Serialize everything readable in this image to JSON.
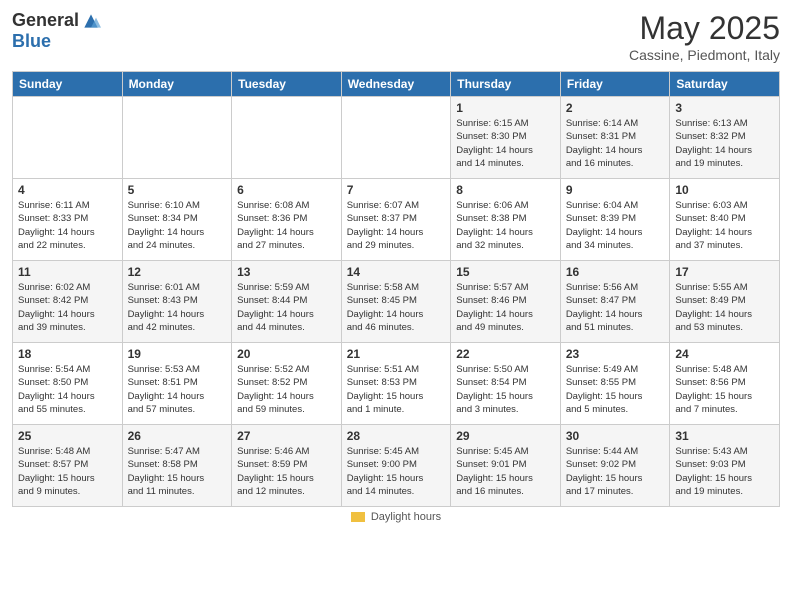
{
  "header": {
    "logo_general": "General",
    "logo_blue": "Blue",
    "month_title": "May 2025",
    "subtitle": "Cassine, Piedmont, Italy"
  },
  "calendar": {
    "days_of_week": [
      "Sunday",
      "Monday",
      "Tuesday",
      "Wednesday",
      "Thursday",
      "Friday",
      "Saturday"
    ],
    "weeks": [
      [
        {
          "day": "",
          "info": ""
        },
        {
          "day": "",
          "info": ""
        },
        {
          "day": "",
          "info": ""
        },
        {
          "day": "",
          "info": ""
        },
        {
          "day": "1",
          "info": "Sunrise: 6:15 AM\nSunset: 8:30 PM\nDaylight: 14 hours\nand 14 minutes."
        },
        {
          "day": "2",
          "info": "Sunrise: 6:14 AM\nSunset: 8:31 PM\nDaylight: 14 hours\nand 16 minutes."
        },
        {
          "day": "3",
          "info": "Sunrise: 6:13 AM\nSunset: 8:32 PM\nDaylight: 14 hours\nand 19 minutes."
        }
      ],
      [
        {
          "day": "4",
          "info": "Sunrise: 6:11 AM\nSunset: 8:33 PM\nDaylight: 14 hours\nand 22 minutes."
        },
        {
          "day": "5",
          "info": "Sunrise: 6:10 AM\nSunset: 8:34 PM\nDaylight: 14 hours\nand 24 minutes."
        },
        {
          "day": "6",
          "info": "Sunrise: 6:08 AM\nSunset: 8:36 PM\nDaylight: 14 hours\nand 27 minutes."
        },
        {
          "day": "7",
          "info": "Sunrise: 6:07 AM\nSunset: 8:37 PM\nDaylight: 14 hours\nand 29 minutes."
        },
        {
          "day": "8",
          "info": "Sunrise: 6:06 AM\nSunset: 8:38 PM\nDaylight: 14 hours\nand 32 minutes."
        },
        {
          "day": "9",
          "info": "Sunrise: 6:04 AM\nSunset: 8:39 PM\nDaylight: 14 hours\nand 34 minutes."
        },
        {
          "day": "10",
          "info": "Sunrise: 6:03 AM\nSunset: 8:40 PM\nDaylight: 14 hours\nand 37 minutes."
        }
      ],
      [
        {
          "day": "11",
          "info": "Sunrise: 6:02 AM\nSunset: 8:42 PM\nDaylight: 14 hours\nand 39 minutes."
        },
        {
          "day": "12",
          "info": "Sunrise: 6:01 AM\nSunset: 8:43 PM\nDaylight: 14 hours\nand 42 minutes."
        },
        {
          "day": "13",
          "info": "Sunrise: 5:59 AM\nSunset: 8:44 PM\nDaylight: 14 hours\nand 44 minutes."
        },
        {
          "day": "14",
          "info": "Sunrise: 5:58 AM\nSunset: 8:45 PM\nDaylight: 14 hours\nand 46 minutes."
        },
        {
          "day": "15",
          "info": "Sunrise: 5:57 AM\nSunset: 8:46 PM\nDaylight: 14 hours\nand 49 minutes."
        },
        {
          "day": "16",
          "info": "Sunrise: 5:56 AM\nSunset: 8:47 PM\nDaylight: 14 hours\nand 51 minutes."
        },
        {
          "day": "17",
          "info": "Sunrise: 5:55 AM\nSunset: 8:49 PM\nDaylight: 14 hours\nand 53 minutes."
        }
      ],
      [
        {
          "day": "18",
          "info": "Sunrise: 5:54 AM\nSunset: 8:50 PM\nDaylight: 14 hours\nand 55 minutes."
        },
        {
          "day": "19",
          "info": "Sunrise: 5:53 AM\nSunset: 8:51 PM\nDaylight: 14 hours\nand 57 minutes."
        },
        {
          "day": "20",
          "info": "Sunrise: 5:52 AM\nSunset: 8:52 PM\nDaylight: 14 hours\nand 59 minutes."
        },
        {
          "day": "21",
          "info": "Sunrise: 5:51 AM\nSunset: 8:53 PM\nDaylight: 15 hours\nand 1 minute."
        },
        {
          "day": "22",
          "info": "Sunrise: 5:50 AM\nSunset: 8:54 PM\nDaylight: 15 hours\nand 3 minutes."
        },
        {
          "day": "23",
          "info": "Sunrise: 5:49 AM\nSunset: 8:55 PM\nDaylight: 15 hours\nand 5 minutes."
        },
        {
          "day": "24",
          "info": "Sunrise: 5:48 AM\nSunset: 8:56 PM\nDaylight: 15 hours\nand 7 minutes."
        }
      ],
      [
        {
          "day": "25",
          "info": "Sunrise: 5:48 AM\nSunset: 8:57 PM\nDaylight: 15 hours\nand 9 minutes."
        },
        {
          "day": "26",
          "info": "Sunrise: 5:47 AM\nSunset: 8:58 PM\nDaylight: 15 hours\nand 11 minutes."
        },
        {
          "day": "27",
          "info": "Sunrise: 5:46 AM\nSunset: 8:59 PM\nDaylight: 15 hours\nand 12 minutes."
        },
        {
          "day": "28",
          "info": "Sunrise: 5:45 AM\nSunset: 9:00 PM\nDaylight: 15 hours\nand 14 minutes."
        },
        {
          "day": "29",
          "info": "Sunrise: 5:45 AM\nSunset: 9:01 PM\nDaylight: 15 hours\nand 16 minutes."
        },
        {
          "day": "30",
          "info": "Sunrise: 5:44 AM\nSunset: 9:02 PM\nDaylight: 15 hours\nand 17 minutes."
        },
        {
          "day": "31",
          "info": "Sunrise: 5:43 AM\nSunset: 9:03 PM\nDaylight: 15 hours\nand 19 minutes."
        }
      ]
    ]
  },
  "footer": {
    "daylight_label": "Daylight hours"
  }
}
